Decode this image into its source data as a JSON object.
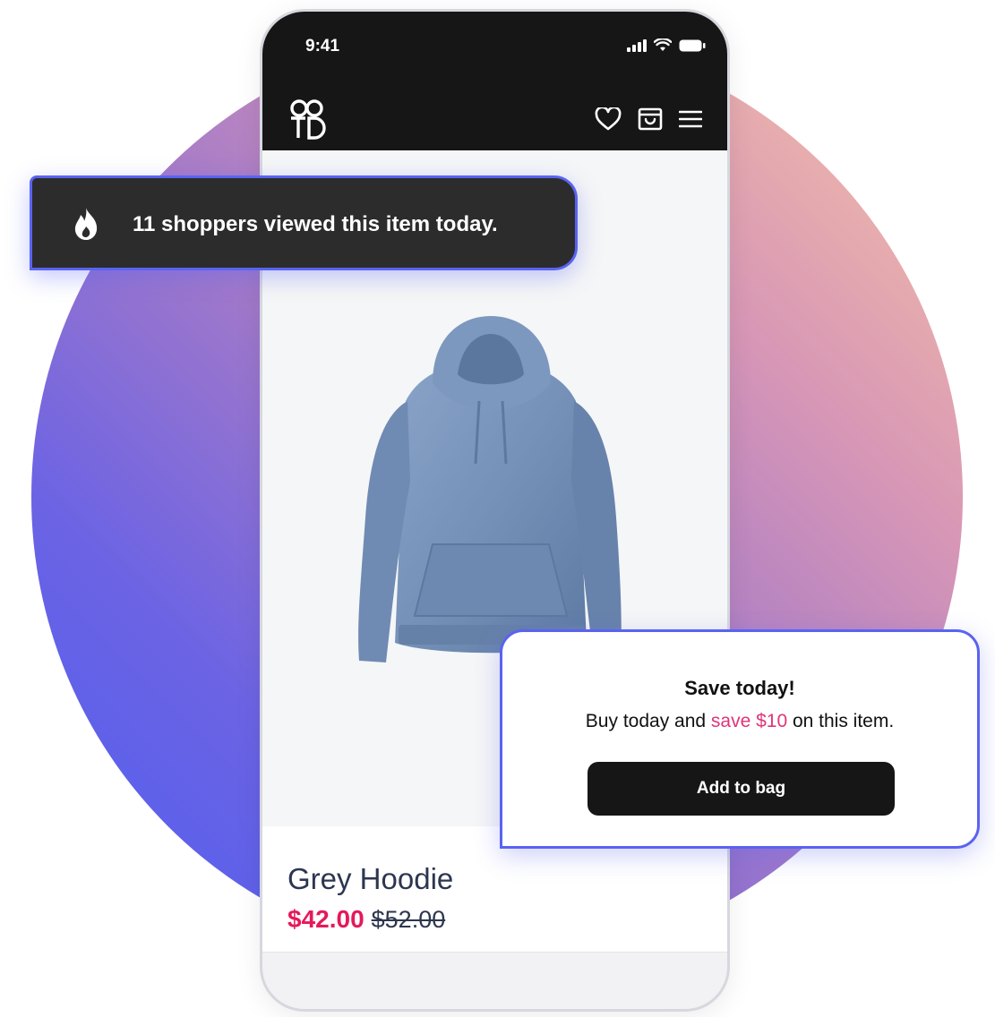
{
  "status_bar": {
    "time": "9:41",
    "icons": [
      "signal-icon",
      "wifi-icon",
      "battery-icon"
    ]
  },
  "nav": {
    "logo": "TD",
    "icons": [
      "heart-icon",
      "shopping-bag-icon",
      "menu-icon"
    ]
  },
  "toast": {
    "icon": "flame-icon",
    "text": "11 shoppers viewed this item today."
  },
  "product": {
    "image": "hoodie-image",
    "name": "Grey Hoodie",
    "price_sale": "$42.00",
    "price_original": "$52.00"
  },
  "offer": {
    "title": "Save today!",
    "desc_before": "Buy today and ",
    "desc_highlight": "save $10",
    "desc_after": " on this item.",
    "button_label": "Add to bag"
  },
  "colors": {
    "accent_border": "#5a63f0",
    "sale_red": "#e5195a",
    "highlight_pink": "#e0357a",
    "dark": "#161616"
  }
}
